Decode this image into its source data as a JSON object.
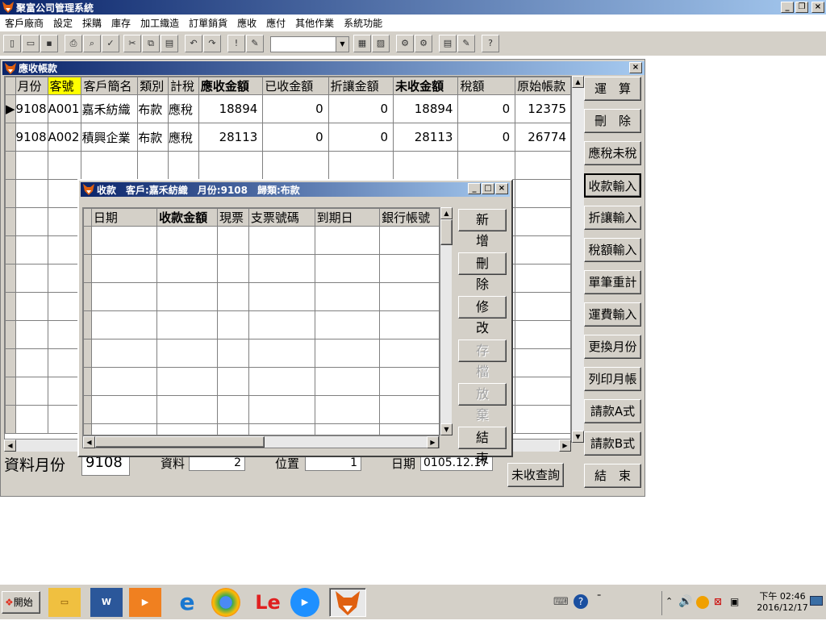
{
  "app": {
    "title": "聚富公司管理系統"
  },
  "menu": [
    "客戶廠商",
    "設定",
    "採購",
    "庫存",
    "加工織造",
    "訂單銷貨",
    "應收",
    "應付",
    "其他作業",
    "系統功能"
  ],
  "ar": {
    "title": "應收帳款",
    "columns": [
      "月份",
      "客號",
      "客戶簡名",
      "類別",
      "計稅",
      "應收金額",
      "已收金額",
      "折讓金額",
      "未收金額",
      "稅額",
      "原始帳款"
    ],
    "rows": [
      [
        "9108",
        "A001",
        "嘉禾紡織",
        "布款",
        "應稅",
        "18894",
        "0",
        "0",
        "18894",
        "0",
        "12375"
      ],
      [
        "9108",
        "A002",
        "積興企業",
        "布款",
        "應稅",
        "28113",
        "0",
        "0",
        "28113",
        "0",
        "26774"
      ]
    ],
    "buttons": [
      "運　算",
      "刪　除",
      "應稅未稅",
      "收款輸入",
      "折讓輸入",
      "稅額輸入",
      "單筆重計",
      "運費輸入",
      "更換月份",
      "列印月帳",
      "請款A式",
      "請款B式",
      "結　束"
    ],
    "footer": {
      "month_label": "資料月份",
      "month_value": "9108",
      "data_label": "資料",
      "data_value": "2",
      "pos_label": "位置",
      "pos_value": "1",
      "date_label": "日期",
      "date_value": "0105.12.17",
      "query_button": "未收查詢"
    }
  },
  "receipt": {
    "title": "收款　客戶:嘉禾紡織　月份:9108　歸類:布款",
    "columns": [
      "日期",
      "收款金額",
      "現票",
      "支票號碼",
      "到期日",
      "銀行帳號"
    ],
    "buttons": [
      "新增",
      "刪除",
      "修改",
      "存檔",
      "放棄",
      "結束"
    ]
  },
  "taskbar": {
    "start_label": "開始",
    "time": "下午 02:46",
    "date": "2016/12/17"
  }
}
